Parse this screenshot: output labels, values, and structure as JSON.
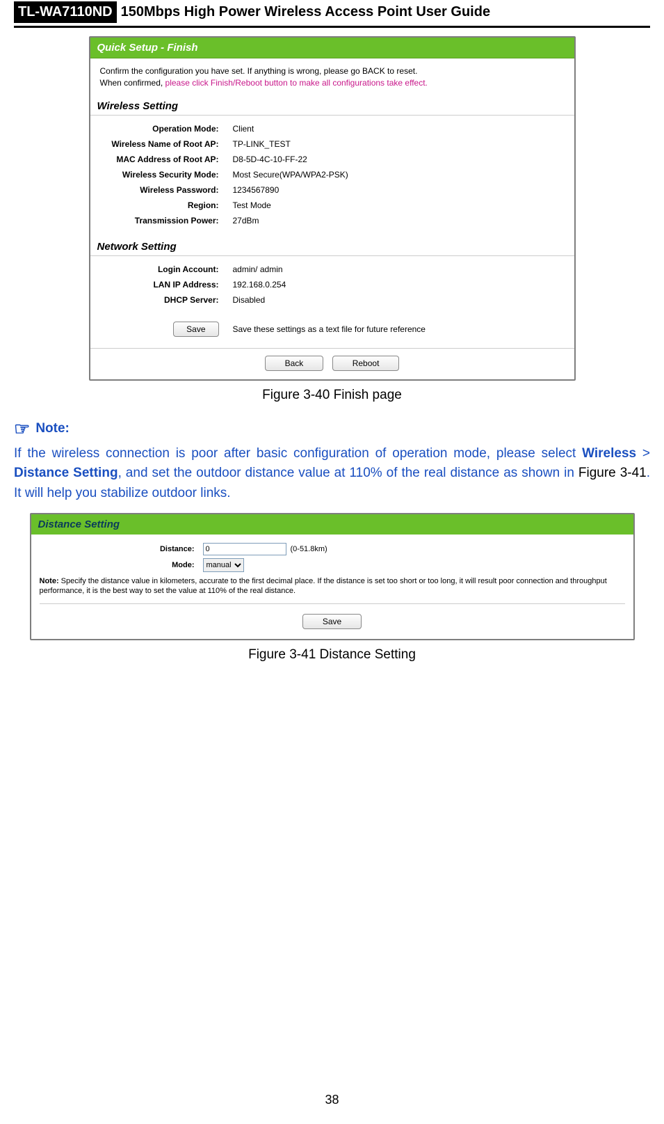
{
  "header": {
    "model": "TL-WA7110ND",
    "title": "150Mbps High Power Wireless Access Point User Guide"
  },
  "fig1": {
    "bar": "Quick Setup - Finish",
    "confirm_line1": "Confirm the configuration you have set. If anything is wrong, please go BACK to reset.",
    "confirm_line2": "When confirmed, please click Finish/Reboot button to make all configurations take effect.",
    "ws_head": "Wireless Setting",
    "ws": {
      "op_mode_l": "Operation Mode:",
      "op_mode_v": "Client",
      "wname_l": "Wireless Name of Root AP:",
      "wname_v": "TP-LINK_TEST",
      "mac_l": "MAC Address of Root AP:",
      "mac_v": "D8-5D-4C-10-FF-22",
      "sec_l": "Wireless Security Mode:",
      "sec_v": "Most Secure(WPA/WPA2-PSK)",
      "pwd_l": "Wireless Password:",
      "pwd_v": "1234567890",
      "reg_l": "Region:",
      "reg_v": "Test Mode",
      "tx_l": "Transmission Power:",
      "tx_v": "27dBm"
    },
    "ns_head": "Network Setting",
    "ns": {
      "login_l": "Login Account:",
      "login_v": "admin/ admin",
      "lan_l": "LAN IP Address:",
      "lan_v": "192.168.0.254",
      "dhcp_l": "DHCP Server:",
      "dhcp_v": "Disabled"
    },
    "save_btn": "Save",
    "save_hint": "Save these settings as a text file for future reference",
    "back_btn": "Back",
    "reboot_btn": "Reboot",
    "caption": "Figure 3-40 Finish page"
  },
  "note": {
    "icon": "☞",
    "head": "Note:",
    "t1": "If the wireless connection is poor after basic configuration of operation mode, please   select ",
    "b1": "Wireless",
    "gt": " > ",
    "b2": "Distance Setting",
    "t2": ", and set the outdoor distance value at 110% of the real distance as shown in ",
    "figref": "Figure 3-41",
    "t3": ". It will help you stabilize outdoor links."
  },
  "fig2": {
    "bar": "Distance Setting",
    "dist_l": "Distance:",
    "dist_v": "0",
    "dist_hint": "(0-51.8km)",
    "mode_l": "Mode:",
    "mode_v": "manual",
    "note_b": "Note:",
    "note_t": " Specify the distance value in kilometers, accurate to the first decimal place. If the distance is set too short or too long, it will result poor connection and throughput performance, it is the best way to set the value at 110% of the real distance.",
    "save_btn": "Save",
    "caption": "Figure 3-41 Distance Setting"
  },
  "page_number": "38"
}
